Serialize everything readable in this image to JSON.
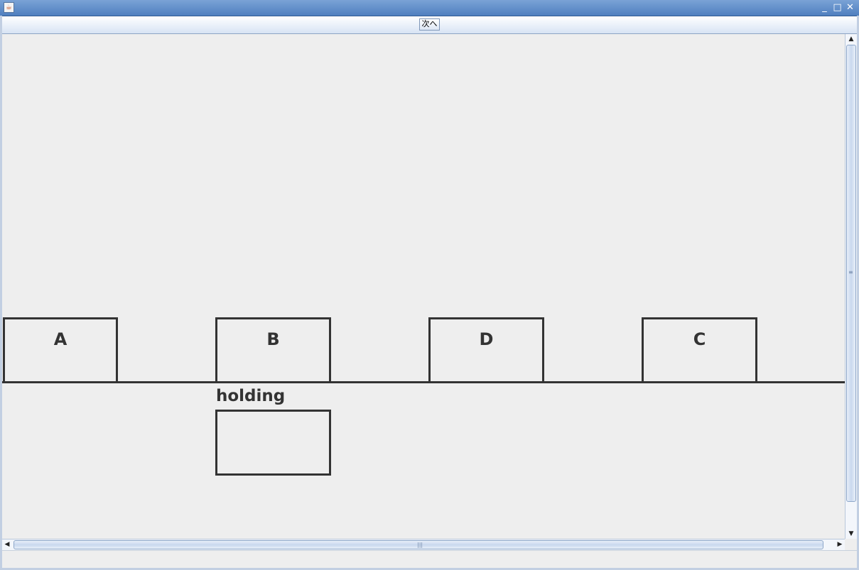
{
  "window": {
    "icon": "java-icon",
    "controls": [
      "minimize-icon",
      "maximize-icon",
      "close-icon"
    ]
  },
  "toolbar": {
    "next_label": "次へ"
  },
  "canvas": {
    "boxes": [
      {
        "label": "A"
      },
      {
        "label": "B"
      },
      {
        "label": "D"
      },
      {
        "label": "C"
      }
    ],
    "holding": {
      "label": "holding"
    }
  },
  "colors": {
    "stroke": "#333333",
    "background": "#eeeeee"
  }
}
